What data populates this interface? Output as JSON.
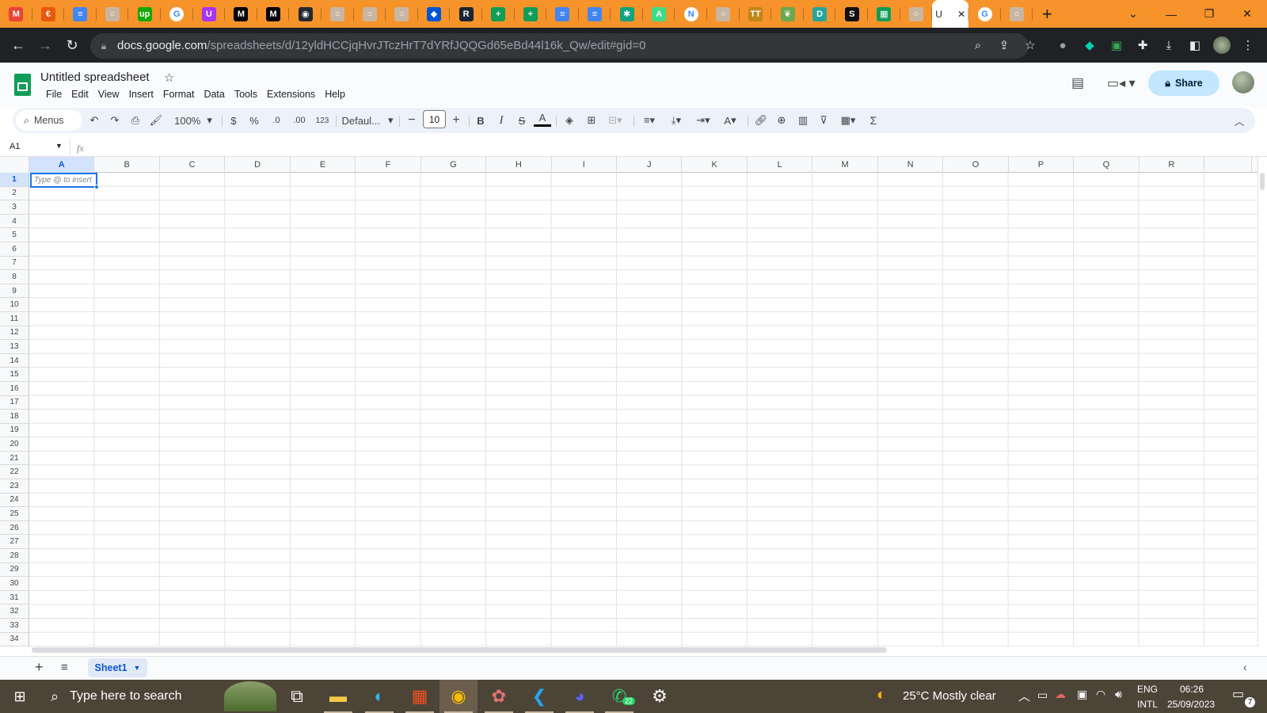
{
  "browser": {
    "tabs": [
      {
        "icon": "gmail-icon",
        "color": "#ea4335",
        "glyph": "M"
      },
      {
        "icon": "orange-circle-icon",
        "color": "#e8590c",
        "glyph": "€"
      },
      {
        "icon": "google-docs-icon",
        "color": "#4285f4",
        "glyph": "≡"
      },
      {
        "icon": "blank-page-icon",
        "color": "#c9b6a2",
        "glyph": "○"
      },
      {
        "icon": "upwork-icon",
        "color": "#14a800",
        "glyph": "up"
      },
      {
        "icon": "google-icon",
        "color": "#ffffff",
        "glyph": "G"
      },
      {
        "icon": "udemy-icon",
        "color": "#a435f0",
        "glyph": "U"
      },
      {
        "icon": "medium-icon",
        "color": "#000000",
        "glyph": "M"
      },
      {
        "icon": "medium-icon",
        "color": "#000000",
        "glyph": "M"
      },
      {
        "icon": "github-icon",
        "color": "#24292f",
        "glyph": "◉"
      },
      {
        "icon": "blank-page-icon",
        "color": "#c9b6a2",
        "glyph": "○"
      },
      {
        "icon": "blank-page-icon",
        "color": "#c9b6a2",
        "glyph": "○"
      },
      {
        "icon": "blank-page-icon",
        "color": "#c9b6a2",
        "glyph": "○"
      },
      {
        "icon": "coursera-icon",
        "color": "#0056d2",
        "glyph": "◆"
      },
      {
        "icon": "replit-icon",
        "color": "#1c2333",
        "glyph": "R"
      },
      {
        "icon": "google-sheets-icon",
        "color": "#0f9d58",
        "glyph": "+"
      },
      {
        "icon": "google-sheets-icon",
        "color": "#0f9d58",
        "glyph": "+"
      },
      {
        "icon": "google-docs-icon",
        "color": "#4285f4",
        "glyph": "≡"
      },
      {
        "icon": "google-docs-icon",
        "color": "#4285f4",
        "glyph": "≡"
      },
      {
        "icon": "chatgpt-icon",
        "color": "#10a37f",
        "glyph": "✱"
      },
      {
        "icon": "android-icon",
        "color": "#3ddc84",
        "glyph": "A"
      },
      {
        "icon": "notion-icon",
        "color": "#ffffff",
        "glyph": "N"
      },
      {
        "icon": "blank-page-icon",
        "color": "#c9b6a2",
        "glyph": "○"
      },
      {
        "icon": "trello-icon",
        "color": "#c2851a",
        "glyph": "TT"
      },
      {
        "icon": "leaf-icon",
        "color": "#6aa84f",
        "glyph": "❦"
      },
      {
        "icon": "d-icon",
        "color": "#26a69a",
        "glyph": "D"
      },
      {
        "icon": "s-icon",
        "color": "#111111",
        "glyph": "S"
      },
      {
        "icon": "google-sheets-icon",
        "color": "#0f9d58",
        "glyph": "▦"
      },
      {
        "icon": "blank-page-icon",
        "color": "#c9b6a2",
        "glyph": "○"
      }
    ],
    "active_tab_text": "U",
    "after_tabs": [
      {
        "icon": "google-icon",
        "color": "#ffffff",
        "glyph": "G"
      },
      {
        "icon": "blank-page-icon",
        "color": "#c9b6a2",
        "glyph": "○"
      }
    ],
    "new_tab_label": "+",
    "url_host": "docs.google.com",
    "url_path": "/spreadsheets/d/12yldHCCjqHvrJTczHrT7dYRfJQQGd65eBd44l16k_Qw/edit#gid=0"
  },
  "sheets": {
    "doc_title": "Untitled spreadsheet",
    "menus": [
      "File",
      "Edit",
      "View",
      "Insert",
      "Format",
      "Data",
      "Tools",
      "Extensions",
      "Help"
    ],
    "share_label": "Share",
    "toolbar": {
      "search_label": "Menus",
      "zoom": "100%",
      "currency": "$",
      "percent": "%",
      "dec_decrease": ".0",
      "dec_increase": ".00",
      "format_123": "123",
      "font": "Defaul...",
      "font_size": "10",
      "bold": "B",
      "italic": "I",
      "strike": "S",
      "text_color": "A",
      "rotate": "A",
      "sigma": "Σ"
    },
    "name_box": "A1",
    "fx": "fx",
    "columns": [
      "A",
      "B",
      "C",
      "D",
      "E",
      "F",
      "G",
      "H",
      "I",
      "J",
      "K",
      "L",
      "M",
      "N",
      "O",
      "P",
      "Q",
      "R"
    ],
    "rows": [
      "1",
      "2",
      "3",
      "4",
      "5",
      "6",
      "7",
      "8",
      "9",
      "10",
      "11",
      "12",
      "13",
      "14",
      "15",
      "16",
      "17",
      "18",
      "19",
      "20",
      "21",
      "22",
      "23",
      "24",
      "25",
      "26",
      "27",
      "28",
      "29",
      "30",
      "31",
      "32",
      "33",
      "34"
    ],
    "active_cell_placeholder": "Type @ to insert",
    "sheet_tab": "Sheet1"
  },
  "taskbar": {
    "search_placeholder": "Type here to search",
    "apps": [
      {
        "name": "task-view-icon",
        "glyph": "⧉",
        "color": "#ffffff"
      },
      {
        "name": "file-explorer-icon",
        "glyph": "▬",
        "color": "#f7c948"
      },
      {
        "name": "edge-icon",
        "glyph": "◐",
        "color": "#2fb5e8"
      },
      {
        "name": "store-icon",
        "glyph": "▦",
        "color": "#f25022"
      },
      {
        "name": "chrome-icon",
        "glyph": "◉",
        "color": "#fbbc04"
      },
      {
        "name": "paint-icon",
        "glyph": "✿",
        "color": "#e57373"
      },
      {
        "name": "vscode-icon",
        "glyph": "❮",
        "color": "#23a9f2"
      },
      {
        "name": "discord-icon",
        "glyph": "◕",
        "color": "#5865f2"
      },
      {
        "name": "whatsapp-icon",
        "glyph": "✆",
        "color": "#25d366"
      },
      {
        "name": "settings-icon",
        "glyph": "⚙",
        "color": "#ffffff"
      }
    ],
    "whatsapp_badge": "22",
    "weather": "25°C  Mostly clear",
    "lang_top": "ENG",
    "lang_bottom": "INTL",
    "time": "06:26",
    "date": "25/09/2023",
    "notifications": "7"
  }
}
